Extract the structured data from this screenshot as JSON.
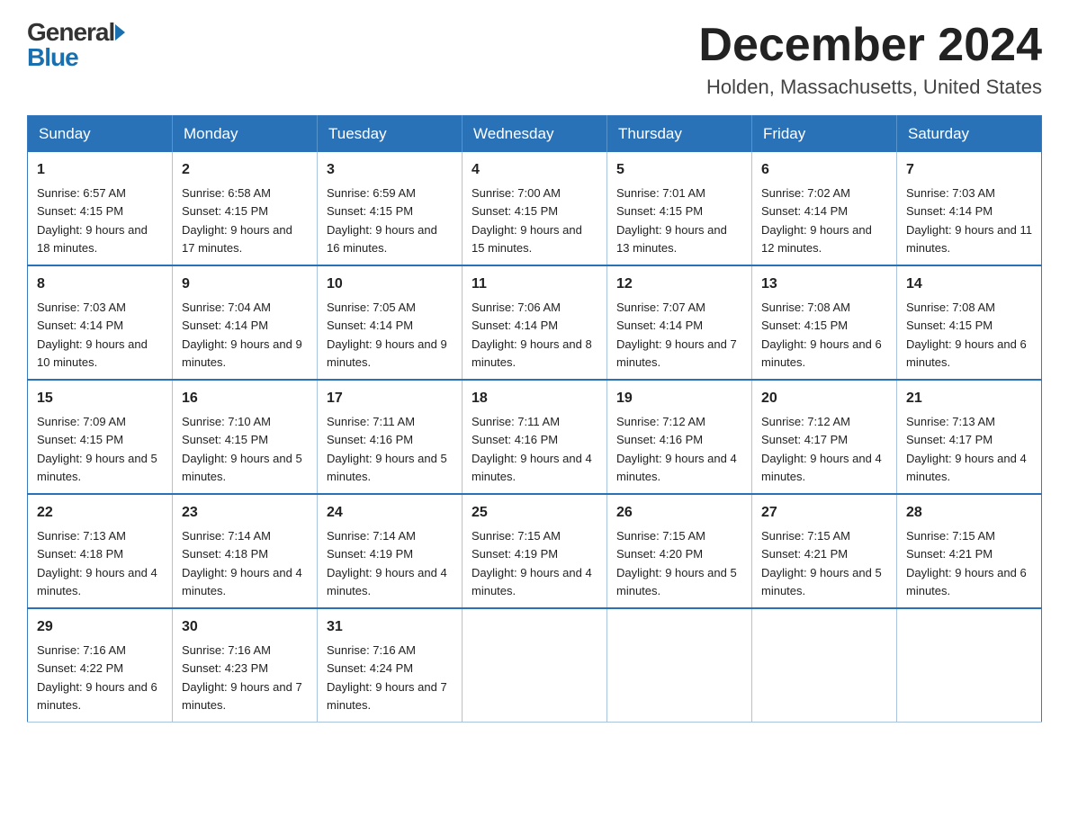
{
  "header": {
    "logo_general": "General",
    "logo_blue": "Blue",
    "month_title": "December 2024",
    "location": "Holden, Massachusetts, United States"
  },
  "days_of_week": [
    "Sunday",
    "Monday",
    "Tuesday",
    "Wednesday",
    "Thursday",
    "Friday",
    "Saturday"
  ],
  "weeks": [
    [
      {
        "day": "1",
        "sunrise": "Sunrise: 6:57 AM",
        "sunset": "Sunset: 4:15 PM",
        "daylight": "Daylight: 9 hours and 18 minutes."
      },
      {
        "day": "2",
        "sunrise": "Sunrise: 6:58 AM",
        "sunset": "Sunset: 4:15 PM",
        "daylight": "Daylight: 9 hours and 17 minutes."
      },
      {
        "day": "3",
        "sunrise": "Sunrise: 6:59 AM",
        "sunset": "Sunset: 4:15 PM",
        "daylight": "Daylight: 9 hours and 16 minutes."
      },
      {
        "day": "4",
        "sunrise": "Sunrise: 7:00 AM",
        "sunset": "Sunset: 4:15 PM",
        "daylight": "Daylight: 9 hours and 15 minutes."
      },
      {
        "day": "5",
        "sunrise": "Sunrise: 7:01 AM",
        "sunset": "Sunset: 4:15 PM",
        "daylight": "Daylight: 9 hours and 13 minutes."
      },
      {
        "day": "6",
        "sunrise": "Sunrise: 7:02 AM",
        "sunset": "Sunset: 4:14 PM",
        "daylight": "Daylight: 9 hours and 12 minutes."
      },
      {
        "day": "7",
        "sunrise": "Sunrise: 7:03 AM",
        "sunset": "Sunset: 4:14 PM",
        "daylight": "Daylight: 9 hours and 11 minutes."
      }
    ],
    [
      {
        "day": "8",
        "sunrise": "Sunrise: 7:03 AM",
        "sunset": "Sunset: 4:14 PM",
        "daylight": "Daylight: 9 hours and 10 minutes."
      },
      {
        "day": "9",
        "sunrise": "Sunrise: 7:04 AM",
        "sunset": "Sunset: 4:14 PM",
        "daylight": "Daylight: 9 hours and 9 minutes."
      },
      {
        "day": "10",
        "sunrise": "Sunrise: 7:05 AM",
        "sunset": "Sunset: 4:14 PM",
        "daylight": "Daylight: 9 hours and 9 minutes."
      },
      {
        "day": "11",
        "sunrise": "Sunrise: 7:06 AM",
        "sunset": "Sunset: 4:14 PM",
        "daylight": "Daylight: 9 hours and 8 minutes."
      },
      {
        "day": "12",
        "sunrise": "Sunrise: 7:07 AM",
        "sunset": "Sunset: 4:14 PM",
        "daylight": "Daylight: 9 hours and 7 minutes."
      },
      {
        "day": "13",
        "sunrise": "Sunrise: 7:08 AM",
        "sunset": "Sunset: 4:15 PM",
        "daylight": "Daylight: 9 hours and 6 minutes."
      },
      {
        "day": "14",
        "sunrise": "Sunrise: 7:08 AM",
        "sunset": "Sunset: 4:15 PM",
        "daylight": "Daylight: 9 hours and 6 minutes."
      }
    ],
    [
      {
        "day": "15",
        "sunrise": "Sunrise: 7:09 AM",
        "sunset": "Sunset: 4:15 PM",
        "daylight": "Daylight: 9 hours and 5 minutes."
      },
      {
        "day": "16",
        "sunrise": "Sunrise: 7:10 AM",
        "sunset": "Sunset: 4:15 PM",
        "daylight": "Daylight: 9 hours and 5 minutes."
      },
      {
        "day": "17",
        "sunrise": "Sunrise: 7:11 AM",
        "sunset": "Sunset: 4:16 PM",
        "daylight": "Daylight: 9 hours and 5 minutes."
      },
      {
        "day": "18",
        "sunrise": "Sunrise: 7:11 AM",
        "sunset": "Sunset: 4:16 PM",
        "daylight": "Daylight: 9 hours and 4 minutes."
      },
      {
        "day": "19",
        "sunrise": "Sunrise: 7:12 AM",
        "sunset": "Sunset: 4:16 PM",
        "daylight": "Daylight: 9 hours and 4 minutes."
      },
      {
        "day": "20",
        "sunrise": "Sunrise: 7:12 AM",
        "sunset": "Sunset: 4:17 PM",
        "daylight": "Daylight: 9 hours and 4 minutes."
      },
      {
        "day": "21",
        "sunrise": "Sunrise: 7:13 AM",
        "sunset": "Sunset: 4:17 PM",
        "daylight": "Daylight: 9 hours and 4 minutes."
      }
    ],
    [
      {
        "day": "22",
        "sunrise": "Sunrise: 7:13 AM",
        "sunset": "Sunset: 4:18 PM",
        "daylight": "Daylight: 9 hours and 4 minutes."
      },
      {
        "day": "23",
        "sunrise": "Sunrise: 7:14 AM",
        "sunset": "Sunset: 4:18 PM",
        "daylight": "Daylight: 9 hours and 4 minutes."
      },
      {
        "day": "24",
        "sunrise": "Sunrise: 7:14 AM",
        "sunset": "Sunset: 4:19 PM",
        "daylight": "Daylight: 9 hours and 4 minutes."
      },
      {
        "day": "25",
        "sunrise": "Sunrise: 7:15 AM",
        "sunset": "Sunset: 4:19 PM",
        "daylight": "Daylight: 9 hours and 4 minutes."
      },
      {
        "day": "26",
        "sunrise": "Sunrise: 7:15 AM",
        "sunset": "Sunset: 4:20 PM",
        "daylight": "Daylight: 9 hours and 5 minutes."
      },
      {
        "day": "27",
        "sunrise": "Sunrise: 7:15 AM",
        "sunset": "Sunset: 4:21 PM",
        "daylight": "Daylight: 9 hours and 5 minutes."
      },
      {
        "day": "28",
        "sunrise": "Sunrise: 7:15 AM",
        "sunset": "Sunset: 4:21 PM",
        "daylight": "Daylight: 9 hours and 6 minutes."
      }
    ],
    [
      {
        "day": "29",
        "sunrise": "Sunrise: 7:16 AM",
        "sunset": "Sunset: 4:22 PM",
        "daylight": "Daylight: 9 hours and 6 minutes."
      },
      {
        "day": "30",
        "sunrise": "Sunrise: 7:16 AM",
        "sunset": "Sunset: 4:23 PM",
        "daylight": "Daylight: 9 hours and 7 minutes."
      },
      {
        "day": "31",
        "sunrise": "Sunrise: 7:16 AM",
        "sunset": "Sunset: 4:24 PM",
        "daylight": "Daylight: 9 hours and 7 minutes."
      },
      null,
      null,
      null,
      null
    ]
  ]
}
